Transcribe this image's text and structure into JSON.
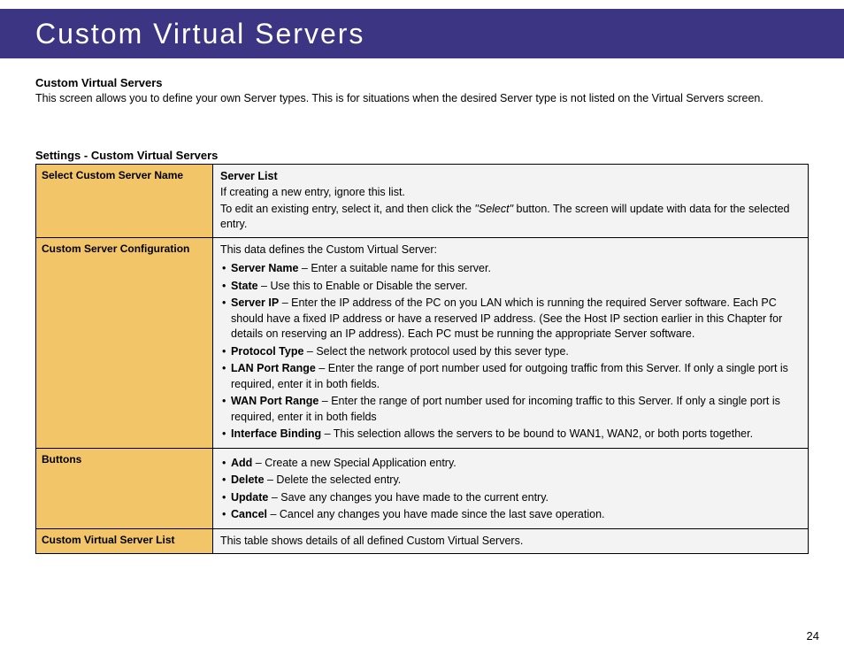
{
  "header": {
    "title": "Custom Virtual Servers"
  },
  "intro": {
    "heading": "Custom Virtual Servers",
    "text": "This screen allows you to define your own Server types. This is for situations when the desired Server type is not listed on the Virtual Servers screen."
  },
  "table": {
    "title": "Settings - Custom Virtual Servers",
    "rows": {
      "r1": {
        "label": "Select Custom Server Name",
        "lead": "Server List",
        "p1": "If creating a new entry, ignore this list.",
        "p2a": "To edit an existing entry, select it, and then click the ",
        "p2quote": "\"Select\"",
        "p2b": " button. The screen will update with data for the selected entry."
      },
      "r2": {
        "label": "Custom Server Configuration",
        "intro": "This data defines the Custom Virtual Server:",
        "items": {
          "serverName": {
            "b": "Server Name",
            "t": " – Enter a suitable name for this server."
          },
          "state": {
            "b": "State",
            "t": " – Use this to Enable or Disable the server."
          },
          "serverIp": {
            "b": "Server IP",
            "t": " – Enter the IP address of the PC on you LAN which is running the required Server software. Each PC should have a fixed IP address or have a reserved IP address. (See the Host IP section earlier in this Chapter for details on reserving an IP address). Each PC must be running the appropriate Server software."
          },
          "protocol": {
            "b": "Protocol Type",
            "t": " – Select the network protocol used by this sever type."
          },
          "lanPort": {
            "b": "LAN Port Range",
            "t": " – Enter the range of port number used for outgoing traffic from this Server. If only a single port is required, enter it in both fields."
          },
          "wanPort": {
            "b": "WAN Port Range",
            "t": " – Enter the range of port number used for incoming traffic to this Server. If only a single port is required, enter it in both fields"
          },
          "iface": {
            "b": "Interface Binding",
            "t": " – This selection allows the servers to be bound to WAN1, WAN2, or both ports together."
          }
        }
      },
      "r3": {
        "label": "Buttons",
        "items": {
          "add": {
            "b": "Add",
            "t": " – Create a new Special Application entry."
          },
          "delete": {
            "b": "Delete",
            "t": " – Delete the selected entry."
          },
          "update": {
            "b": "Update",
            "t": " – Save any changes you have made to the current entry."
          },
          "cancel": {
            "b": "Cancel",
            "t": " – Cancel any changes you have made since the last save operation."
          }
        }
      },
      "r4": {
        "label": "Custom Virtual Server List",
        "text": "This table shows details of all defined Custom Virtual Servers."
      }
    }
  },
  "pageNumber": "24"
}
